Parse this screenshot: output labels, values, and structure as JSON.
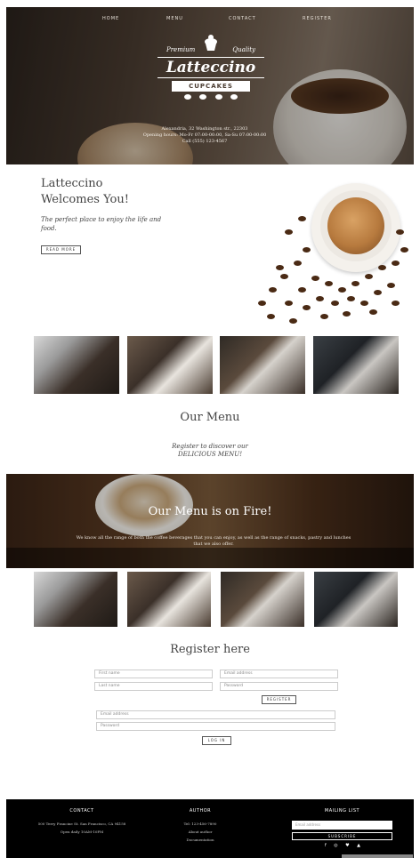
{
  "nav": {
    "items": [
      "HOME",
      "MENU",
      "CONTACT",
      "REGISTER"
    ]
  },
  "logo": {
    "script_left": "Premium",
    "script_right": "Quality",
    "brand": "Latteccino",
    "ribbon": "CUPCAKES"
  },
  "hero": {
    "address": "Alexandria, 32 Washington str., 22303",
    "hours": "Opening hours: Mo-Fr 07:00-00:00, Sa-Su 07:00-00:00",
    "phone": "Call (555) 123-4567"
  },
  "welcome": {
    "title_line1": "Latteccino",
    "title_line2": "Welcomes You!",
    "subtitle": "The perfect place to enjoy the life and food.",
    "button": "READ MORE"
  },
  "menu": {
    "title": "Our Menu",
    "sub_line1": "Register to discover our",
    "sub_line2": "DELICIOUS MENU!"
  },
  "fire": {
    "title": "Our Menu is on Fire!",
    "text": "We know all the range of both the coffee beverages that you can enjoy, as well as the range of snacks, pastry and lunches that we also offer."
  },
  "register": {
    "title": "Register here",
    "first_name": "First name",
    "email": "Email address",
    "last_name": "Last name",
    "password": "Password",
    "register_button": "REGISTER",
    "login_email": "Email address",
    "login_password": "Password",
    "login_button": "LOG IN"
  },
  "footer": {
    "contact_head": "CONTACT",
    "contact_address": "500 Terry Francine St. San Francisco, CA 94158",
    "contact_hours": "Open daily 10AM-10PM",
    "author_head": "AUTHOR",
    "author_tel": "Tel: 123-456-7890",
    "author_about": "About author",
    "author_docs": "Documentation",
    "mailing_head": "MAILING LIST",
    "mailing_placeholder": "Email address",
    "subscribe": "SUBSCRIBE",
    "socials": [
      "f",
      "◎",
      "♥",
      "▲"
    ]
  }
}
